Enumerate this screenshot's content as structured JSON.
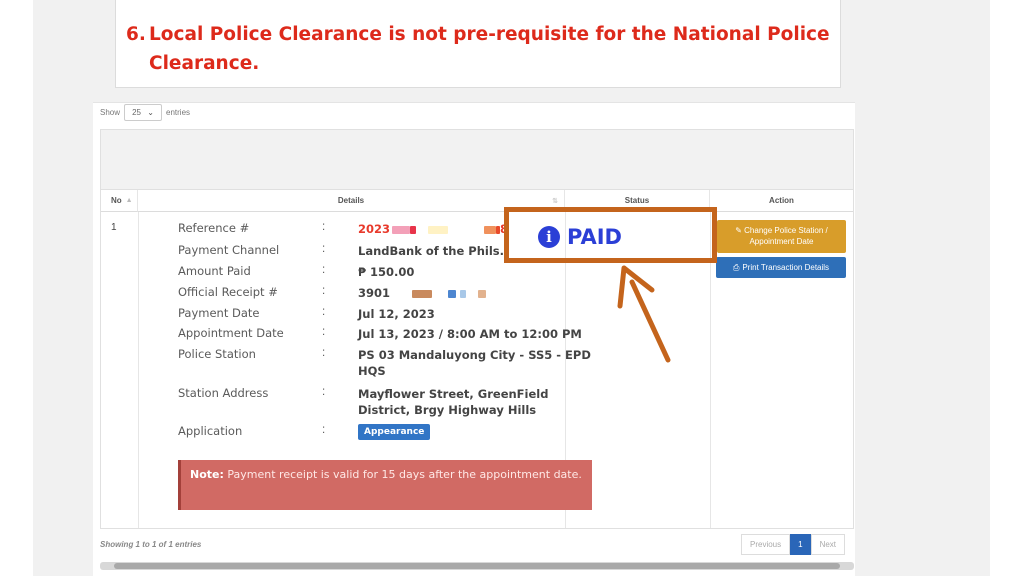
{
  "notice": {
    "number": "6.",
    "text": "Local Police Clearance is not pre-requisite for the National Police Clearance."
  },
  "length_menu": {
    "show": "Show",
    "value": "25",
    "entries": "entries"
  },
  "table": {
    "headers": {
      "no": "No",
      "details": "Details",
      "status": "Status",
      "action": "Action"
    },
    "row": {
      "no": "1",
      "details": [
        {
          "label": "Reference #",
          "value": "2023",
          "value_suffix": "8"
        },
        {
          "label": "Payment Channel",
          "value": "LandBank of the Phils."
        },
        {
          "label": "Amount Paid",
          "value": "₱ 150.00"
        },
        {
          "label": "Official Receipt #",
          "value": "3901"
        },
        {
          "label": "Payment Date",
          "value": "Jul 12, 2023"
        },
        {
          "label": "Appointment Date",
          "value": "Jul 13, 2023 / 8:00 AM to 12:00 PM"
        },
        {
          "label": "Police Station",
          "value": "PS 03 Mandaluyong City - SS5 - EPD HQS"
        },
        {
          "label": "Station Address",
          "value": "Mayflower Street, GreenField District, Brgy Highway Hills"
        },
        {
          "label": "Application",
          "value": "Appearance"
        }
      ],
      "colon": ":",
      "note_label": "Note:",
      "note_text": " Payment receipt is valid for 15 days after the appointment date.",
      "status": "PAID",
      "actions": {
        "change": "Change Police Station / Appointment Date",
        "print": "Print Transaction Details"
      }
    }
  },
  "footer": {
    "showing": "Showing 1 to 1 of 1 entries",
    "previous": "Previous",
    "page": "1",
    "next": "Next"
  },
  "colors": {
    "notice_red": "#dd2a1b",
    "paid_blue": "#2b3fd6",
    "highlight_orange": "#c4641c",
    "change_button": "#d89d2a",
    "print_button": "#2e6fb8",
    "note_bg": "#d16a64"
  },
  "icons": [
    "info-circle-icon",
    "edit-icon",
    "print-icon",
    "sort-icon",
    "chevron-down-icon",
    "arrow-annotation"
  ]
}
